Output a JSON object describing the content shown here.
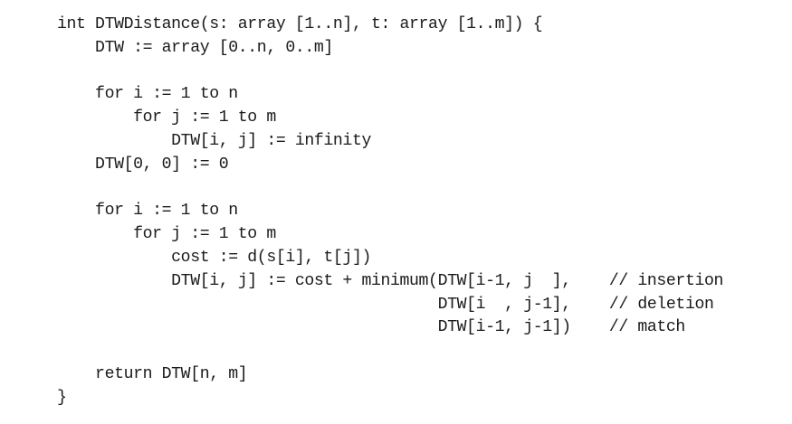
{
  "code_listing": {
    "lines": [
      "int DTWDistance(s: array [1..n], t: array [1..m]) {",
      "    DTW := array [0..n, 0..m]",
      "",
      "    for i := 1 to n",
      "        for j := 1 to m",
      "            DTW[i, j] := infinity",
      "    DTW[0, 0] := 0",
      "",
      "    for i := 1 to n",
      "        for j := 1 to m",
      "            cost := d(s[i], t[j])",
      "            DTW[i, j] := cost + minimum(DTW[i-1, j  ],    // insertion",
      "                                        DTW[i  , j-1],    // deletion",
      "                                        DTW[i-1, j-1])    // match",
      "",
      "    return DTW[n, m]",
      "}"
    ]
  }
}
